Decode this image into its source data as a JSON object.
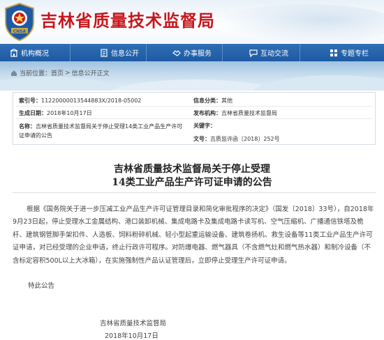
{
  "site": {
    "title": "吉林省质量技术监督局",
    "brand_color": "#c8161d"
  },
  "nav": {
    "items": [
      {
        "label": "机构概况",
        "icon": "building-icon"
      },
      {
        "label": "信息公开",
        "icon": "document-icon"
      },
      {
        "label": "办事服务",
        "icon": "handshake-icon"
      },
      {
        "label": "互动交流",
        "icon": "chat-icon"
      },
      {
        "label": "专题专栏",
        "icon": "grid-icon"
      }
    ],
    "color": "#1d5aa3"
  },
  "breadcrumb": {
    "prefix": "当前位置：",
    "home": "首页",
    "sep1": ">",
    "section": "信息公开正文"
  },
  "info": {
    "index_label": "索引号：",
    "index_value": "11220000013544883X/2018-05002",
    "category_label": "信息分类：",
    "category_value": "其他",
    "date_label": "生成日期：",
    "date_value": "2018年10月17日",
    "org_label": "发布机构：",
    "org_value": "吉林省质量技术监督局",
    "name_label": "名称：",
    "name_value": "吉林省质量技术监督局关于停止受理14类工业产品生产许可证申请的公告",
    "keyword_label": "关键字：",
    "keyword_value": "",
    "docno_label": "文号：",
    "docno_value": "吉质监许函〔2018〕252号"
  },
  "article": {
    "title_line1": "吉林省质量技术监督局关于停止受理",
    "title_line2": "14类工业产品生产许可证申请的公告",
    "body": "根据《国务院关于进一步压减工业产品生产许可证管理目录和简化审批程序的决定》（国发〔2018〕33号），自2018年9月23日起，停止受理水工金属结构、港口装卸机械、集成电路卡及集成电路卡读写机、空气压缩机、广播通信铁塔及桅杆、建筑钢管脚手架扣件、人造板、饲料粉碎机械、轻小型起重运输设备、建筑卷扬机、救生设备等11类工业产品生产许可证申请，对已经受理的企业申请，终止行政许可程序。对防爆电器、燃气器具（不含燃气灶和燃气热水器）和制冷设备（不含标定容积500L以上大冰箱），在实施强制性产品认证管理后，立即停止受理生产许可证申请。",
    "closing": "特此公告",
    "signature": "吉林省质量技术监督局",
    "sign_date": "2018年10月17日"
  }
}
